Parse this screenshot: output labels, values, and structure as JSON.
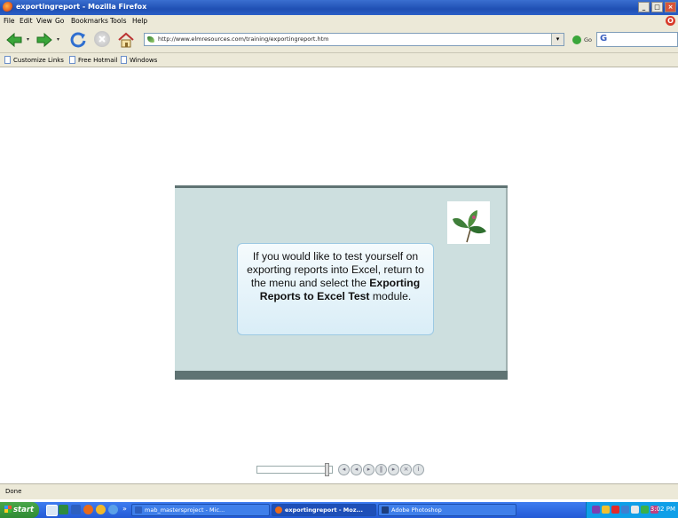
{
  "window": {
    "title": "exportingreport - Mozilla Firefox",
    "controls": [
      "_",
      "□",
      "×"
    ]
  },
  "menu": [
    "File",
    "Edit",
    "View",
    "Go",
    "Bookmarks",
    "Tools",
    "Help"
  ],
  "toolbar": {
    "url": "http://www.elmresources.com/training/exportingreport.htm",
    "go_label": "Go",
    "search_glyph": "G"
  },
  "bookmarks": [
    "Customize Links",
    "Free Hotmail",
    "Windows"
  ],
  "slide": {
    "text_before": "If you would like to test yourself on exporting reports into Excel, return to the menu and select the ",
    "module_name": "Exporting Reports to Excel Test",
    "text_after": " module."
  },
  "media": {
    "progress": 0.95
  },
  "status": "Done",
  "taskbar": {
    "start_label": "start",
    "overflow": "»",
    "tasks": [
      "mab_mastersproject - Mic...",
      "exportingreport - Moz...",
      "Adobe Photoshop"
    ],
    "clock": "3:02 PM"
  }
}
